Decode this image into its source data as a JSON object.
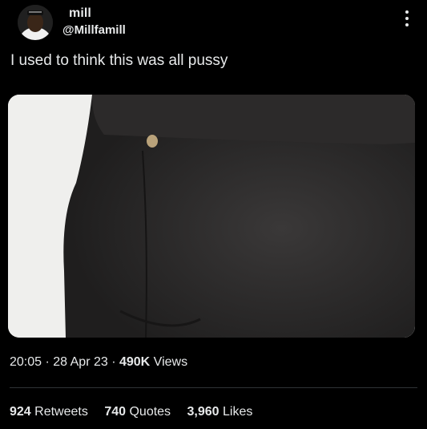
{
  "author": {
    "display_name": "mill",
    "handle": "@Millfamill"
  },
  "tweet": {
    "text": "I used to think this was all pussy"
  },
  "meta": {
    "time": "20:05",
    "sep1": " · ",
    "date": "28 Apr 23",
    "sep2": " · ",
    "views_count": "490K",
    "views_label": " Views"
  },
  "stats": {
    "retweets_count": "924",
    "retweets_label": "Retweets",
    "quotes_count": "740",
    "quotes_label": "Quotes",
    "likes_count": "3,960",
    "likes_label": "Likes"
  },
  "icons": {
    "more": "more-vertical-icon"
  },
  "colors": {
    "background": "#000000",
    "text": "#e7e9ea",
    "divider": "#2f3336"
  }
}
